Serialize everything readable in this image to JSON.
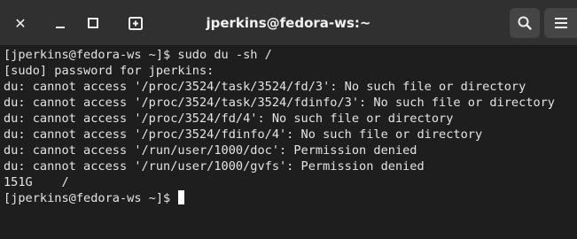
{
  "window": {
    "title": "jperkins@fedora-ws:~"
  },
  "icons": {
    "close": "close-icon",
    "minimize": "minimize-icon",
    "maximize": "maximize-icon",
    "new_tab": "new-tab-icon",
    "search": "search-icon",
    "menu": "hamburger-menu-icon"
  },
  "colors": {
    "titlebar": "#303030",
    "terminal_bg": "#1e1e1e",
    "terminal_fg": "#e4e4e4",
    "header_button": "#454545"
  },
  "terminal": {
    "lines": [
      "[jperkins@fedora-ws ~]$ sudo du -sh /",
      "[sudo] password for jperkins:",
      "du: cannot access '/proc/3524/task/3524/fd/3': No such file or directory",
      "du: cannot access '/proc/3524/task/3524/fdinfo/3': No such file or directory",
      "du: cannot access '/proc/3524/fd/4': No such file or directory",
      "du: cannot access '/proc/3524/fdinfo/4': No such file or directory",
      "du: cannot access '/run/user/1000/doc': Permission denied",
      "du: cannot access '/run/user/1000/gvfs': Permission denied",
      "151G    /"
    ],
    "prompt": "[jperkins@fedora-ws ~]$ "
  }
}
